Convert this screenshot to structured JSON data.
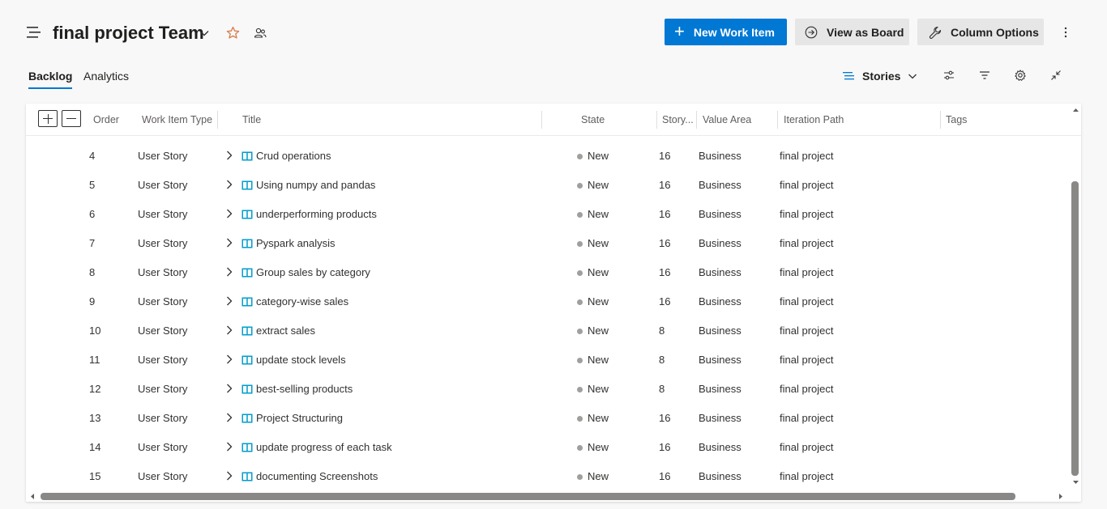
{
  "header": {
    "title": "final project Team",
    "new_work_item": "New Work Item",
    "view_as_board": "View as Board",
    "column_options": "Column Options"
  },
  "tabs": [
    {
      "label": "Backlog",
      "active": true
    },
    {
      "label": "Analytics",
      "active": false
    }
  ],
  "toolbar": {
    "level": "Stories"
  },
  "grid": {
    "columns": {
      "order": "Order",
      "type": "Work Item Type",
      "title": "Title",
      "state": "State",
      "points": "Story...",
      "area": "Value Area",
      "iteration": "Iteration Path",
      "tags": "Tags"
    },
    "rows": [
      {
        "order": "4",
        "type": "User Story",
        "title": "Crud operations",
        "state": "New",
        "points": "16",
        "area": "Business",
        "iteration": "final project"
      },
      {
        "order": "5",
        "type": "User Story",
        "title": "Using numpy and pandas",
        "state": "New",
        "points": "16",
        "area": "Business",
        "iteration": "final project"
      },
      {
        "order": "6",
        "type": "User Story",
        "title": "underperforming products",
        "state": "New",
        "points": "16",
        "area": "Business",
        "iteration": "final project"
      },
      {
        "order": "7",
        "type": "User Story",
        "title": "Pyspark analysis",
        "state": "New",
        "points": "16",
        "area": "Business",
        "iteration": "final project"
      },
      {
        "order": "8",
        "type": "User Story",
        "title": "Group sales by category",
        "state": "New",
        "points": "16",
        "area": "Business",
        "iteration": "final project"
      },
      {
        "order": "9",
        "type": "User Story",
        "title": "category-wise sales",
        "state": "New",
        "points": "16",
        "area": "Business",
        "iteration": "final project"
      },
      {
        "order": "10",
        "type": "User Story",
        "title": "extract sales",
        "state": "New",
        "points": "8",
        "area": "Business",
        "iteration": "final project"
      },
      {
        "order": "11",
        "type": "User Story",
        "title": "update stock levels",
        "state": "New",
        "points": "8",
        "area": "Business",
        "iteration": "final project"
      },
      {
        "order": "12",
        "type": "User Story",
        "title": "best-selling products",
        "state": "New",
        "points": "8",
        "area": "Business",
        "iteration": "final project"
      },
      {
        "order": "13",
        "type": "User Story",
        "title": "Project Structuring",
        "state": "New",
        "points": "16",
        "area": "Business",
        "iteration": "final project"
      },
      {
        "order": "14",
        "type": "User Story",
        "title": "update progress of each task",
        "state": "New",
        "points": "16",
        "area": "Business",
        "iteration": "final project"
      },
      {
        "order": "15",
        "type": "User Story",
        "title": "documenting Screenshots",
        "state": "New",
        "points": "16",
        "area": "Business",
        "iteration": "final project"
      }
    ]
  },
  "colors": {
    "accent": "#0078d4",
    "star": "#d87d4a",
    "book_icon": "#009ccc",
    "state_new": "#a19f9d"
  },
  "icons": [
    "hamburger-icon",
    "chevron-down-icon",
    "star-icon",
    "team-icon",
    "plus-icon",
    "arrow-circle-icon",
    "wrench-icon",
    "more-vertical-icon",
    "list-lines-icon",
    "settings-sliders-icon",
    "filter-icon",
    "gear-icon",
    "collapse-icon",
    "chevron-right-icon",
    "book-icon"
  ]
}
